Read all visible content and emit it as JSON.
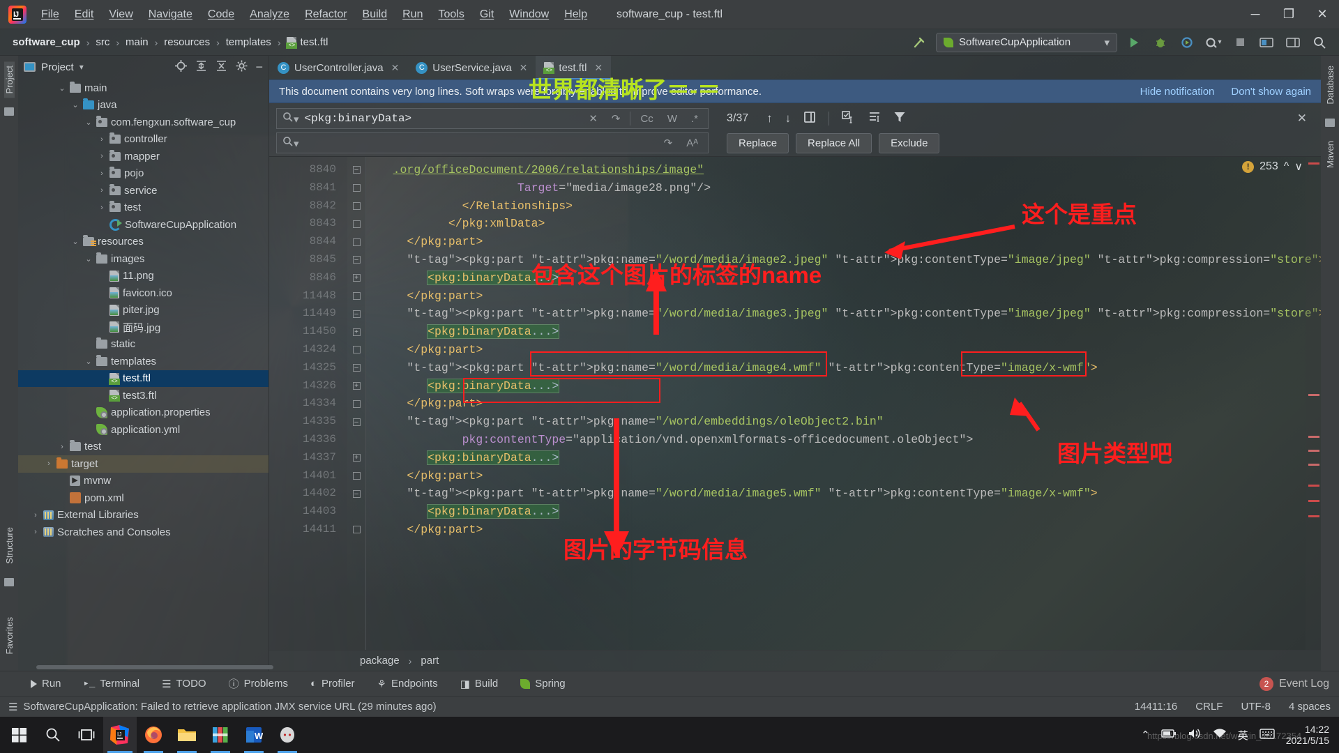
{
  "titlebar": {
    "menu": [
      "File",
      "Edit",
      "View",
      "Navigate",
      "Code",
      "Analyze",
      "Refactor",
      "Build",
      "Run",
      "Tools",
      "Git",
      "Window",
      "Help"
    ],
    "window_title": "software_cup - test.ftl",
    "minimize": "─",
    "maximize": "❐",
    "close": "✕"
  },
  "navbar": {
    "crumbs": [
      "software_cup",
      "src",
      "main",
      "resources",
      "templates",
      "test.ftl"
    ],
    "run_config": "SoftwareCupApplication",
    "hammer_icon": "build-hammer-icon",
    "search_icon": "search-icon"
  },
  "left_strip": {
    "project_label": "Project",
    "structure_label": "Structure",
    "favorites_label": "Favorites"
  },
  "right_strip": {
    "database_label": "Database",
    "maven_label": "Maven"
  },
  "project": {
    "title": "Project",
    "tree": [
      {
        "label": "main",
        "depth": 2,
        "arrow": "⌄",
        "icon": "folder",
        "selected": false
      },
      {
        "label": "java",
        "depth": 3,
        "arrow": "⌄",
        "icon": "folder-blue",
        "selected": false
      },
      {
        "label": "com.fengxun.software_cup",
        "depth": 4,
        "arrow": "⌄",
        "icon": "package",
        "selected": false
      },
      {
        "label": "controller",
        "depth": 5,
        "arrow": "›",
        "icon": "package",
        "selected": false
      },
      {
        "label": "mapper",
        "depth": 5,
        "arrow": "›",
        "icon": "package",
        "selected": false
      },
      {
        "label": "pojo",
        "depth": 5,
        "arrow": "›",
        "icon": "package",
        "selected": false
      },
      {
        "label": "service",
        "depth": 5,
        "arrow": "›",
        "icon": "package",
        "selected": false
      },
      {
        "label": "test",
        "depth": 5,
        "arrow": "›",
        "icon": "package",
        "selected": false
      },
      {
        "label": "SoftwareCupApplication",
        "depth": 5,
        "arrow": "",
        "icon": "spring-boot",
        "selected": false
      },
      {
        "label": "resources",
        "depth": 3,
        "arrow": "⌄",
        "icon": "folder-resources",
        "selected": false
      },
      {
        "label": "images",
        "depth": 4,
        "arrow": "⌄",
        "icon": "folder",
        "selected": false
      },
      {
        "label": "11.png",
        "depth": 5,
        "arrow": "",
        "icon": "image-file",
        "selected": false
      },
      {
        "label": "favicon.ico",
        "depth": 5,
        "arrow": "",
        "icon": "image-file",
        "selected": false
      },
      {
        "label": "piter.jpg",
        "depth": 5,
        "arrow": "",
        "icon": "image-file",
        "selected": false
      },
      {
        "label": "面码.jpg",
        "depth": 5,
        "arrow": "",
        "icon": "image-file",
        "selected": false
      },
      {
        "label": "static",
        "depth": 4,
        "arrow": "",
        "icon": "folder",
        "selected": false
      },
      {
        "label": "templates",
        "depth": 4,
        "arrow": "⌄",
        "icon": "folder",
        "selected": false
      },
      {
        "label": "test.ftl",
        "depth": 5,
        "arrow": "",
        "icon": "ftl-file",
        "selected": true
      },
      {
        "label": "test3.ftl",
        "depth": 5,
        "arrow": "",
        "icon": "ftl-file",
        "selected": false
      },
      {
        "label": "application.properties",
        "depth": 4,
        "arrow": "",
        "icon": "spring-file",
        "selected": false
      },
      {
        "label": "application.yml",
        "depth": 4,
        "arrow": "",
        "icon": "spring-file",
        "selected": false
      },
      {
        "label": "test",
        "depth": 2,
        "arrow": "›",
        "icon": "folder",
        "selected": false
      },
      {
        "label": "target",
        "depth": 1,
        "arrow": "›",
        "icon": "folder-orange",
        "selected": false,
        "highlight": true
      },
      {
        "label": "mvnw",
        "depth": 2,
        "arrow": "",
        "icon": "mvnw-file",
        "selected": false
      },
      {
        "label": "pom.xml",
        "depth": 2,
        "arrow": "",
        "icon": "maven-file",
        "selected": false
      },
      {
        "label": "External Libraries",
        "depth": 0,
        "arrow": "›",
        "icon": "library",
        "selected": false
      },
      {
        "label": "Scratches and Consoles",
        "depth": 0,
        "arrow": "›",
        "icon": "scratches",
        "selected": false
      }
    ]
  },
  "editor": {
    "tabs": [
      {
        "label": "UserController.java",
        "icon": "java-class-icon",
        "active": false
      },
      {
        "label": "UserService.java",
        "icon": "java-class-icon",
        "active": false
      },
      {
        "label": "test.ftl",
        "icon": "ftl-file-icon",
        "active": true
      }
    ],
    "notification": {
      "message": "This document contains very long lines. Soft wraps were forcibly enabled to improve editor performance.",
      "hide_label": "Hide notification",
      "dont_show_label": "Don't show again"
    },
    "find": {
      "query": "<pkg:binaryData>",
      "replace_value": "",
      "counter": "3/37",
      "toggle_case": "Cc",
      "toggle_word": "W",
      "toggle_regex": ".*",
      "buttons": [
        "Replace",
        "Replace All",
        "Exclude"
      ],
      "close_icon": "close-icon",
      "prev_icon": "find-previous-icon",
      "next_icon": "find-next-icon",
      "select_all_icon": "select-all-occurrences-icon",
      "filter_icon": "filter-icon"
    },
    "inspection": {
      "count": "253",
      "up_icon": "prev-problem-icon",
      "down_icon": "next-problem-icon"
    },
    "breadcrumb": [
      "package",
      "part"
    ],
    "lines": [
      {
        "num": "8840",
        "fold": "fold-minus",
        "text": ".org/officeDocument/2006/relationships/image\"",
        "indent": 4,
        "kind": "link"
      },
      {
        "num": "8841",
        "fold": "fold-dot",
        "text": "Target=\"media/image28.png\"/>",
        "indent": 22,
        "kind": "attr-str"
      },
      {
        "num": "8842",
        "fold": "fold-dot",
        "text": "</Relationships>",
        "indent": 14,
        "kind": "tag"
      },
      {
        "num": "8843",
        "fold": "fold-dot",
        "text": "</pkg:xmlData>",
        "indent": 12,
        "kind": "tag"
      },
      {
        "num": "8844",
        "fold": "fold-dot",
        "text": "</pkg:part>",
        "indent": 6,
        "kind": "tag"
      },
      {
        "num": "8845",
        "fold": "fold-minus",
        "text": "<pkg:part pkg:name=\"/word/media/image2.jpeg\" pkg:contentType=\"image/jpeg\" pkg:compression=\"store\">",
        "indent": 6,
        "kind": "part"
      },
      {
        "num": "8846",
        "fold": "fold-plus",
        "text": "<pkg:binaryData...>",
        "indent": 9,
        "kind": "binary"
      },
      {
        "num": "11448",
        "fold": "fold-dot",
        "text": "</pkg:part>",
        "indent": 6,
        "kind": "tag"
      },
      {
        "num": "11449",
        "fold": "fold-minus",
        "text": "<pkg:part pkg:name=\"/word/media/image3.jpeg\" pkg:contentType=\"image/jpeg\" pkg:compression=\"store\">",
        "indent": 6,
        "kind": "part"
      },
      {
        "num": "11450",
        "fold": "fold-plus",
        "text": "<pkg:binaryData...>",
        "indent": 9,
        "kind": "binary"
      },
      {
        "num": "14324",
        "fold": "fold-dot",
        "text": "</pkg:part>",
        "indent": 6,
        "kind": "tag"
      },
      {
        "num": "14325",
        "fold": "fold-minus",
        "text": "<pkg:part pkg:name=\"/word/media/image4.wmf\" pkg:contentType=\"image/x-wmf\">",
        "indent": 6,
        "kind": "part"
      },
      {
        "num": "14326",
        "fold": "fold-plus",
        "text": "<pkg:binaryData...>",
        "indent": 9,
        "kind": "binary"
      },
      {
        "num": "14334",
        "fold": "fold-dot",
        "text": "</pkg:part>",
        "indent": 6,
        "kind": "tag"
      },
      {
        "num": "14335",
        "fold": "fold-minus",
        "text": "<pkg:part pkg:name=\"/word/embeddings/oleObject2.bin\"",
        "indent": 6,
        "kind": "part"
      },
      {
        "num": "14336",
        "fold": "",
        "text": "pkg:contentType=\"application/vnd.openxmlformats-officedocument.oleObject\">",
        "indent": 14,
        "kind": "attr-str"
      },
      {
        "num": "14337",
        "fold": "fold-plus",
        "text": "<pkg:binaryData...>",
        "indent": 9,
        "kind": "binary"
      },
      {
        "num": "14401",
        "fold": "fold-dot",
        "text": "</pkg:part>",
        "indent": 6,
        "kind": "tag"
      },
      {
        "num": "14402",
        "fold": "fold-minus",
        "text": "<pkg:part pkg:name=\"/word/media/image5.wmf\" pkg:contentType=\"image/x-wmf\">",
        "indent": 6,
        "kind": "part"
      },
      {
        "num": "14403",
        "fold": "",
        "text": "<pkg:binaryData...>",
        "indent": 9,
        "kind": "binary"
      },
      {
        "num": "14411",
        "fold": "fold-dot",
        "text": "</pkg:part>",
        "indent": 6,
        "kind": "tag"
      }
    ]
  },
  "annotations": [
    {
      "id": "anno-world-clear",
      "text": "世界都清晰了＝-＝",
      "color": "#b8e41f"
    },
    {
      "id": "anno-key-point",
      "text": "这个是重点",
      "color": "#ff1e1e"
    },
    {
      "id": "anno-tag-name",
      "text": "包含这个图片的标签的name",
      "color": "#ff1e1e"
    },
    {
      "id": "anno-image-type",
      "text": "图片类型吧",
      "color": "#ff1e1e"
    },
    {
      "id": "anno-byte-info",
      "text": "图片的字节码信息",
      "color": "#ff1e1e"
    }
  ],
  "bottom_tools": [
    {
      "label": "Run",
      "icon": "run-icon"
    },
    {
      "label": "Terminal",
      "icon": "terminal-icon"
    },
    {
      "label": "TODO",
      "icon": "todo-icon"
    },
    {
      "label": "Problems",
      "icon": "problems-icon"
    },
    {
      "label": "Profiler",
      "icon": "profiler-icon"
    },
    {
      "label": "Endpoints",
      "icon": "endpoints-icon"
    },
    {
      "label": "Build",
      "icon": "build-icon"
    },
    {
      "label": "Spring",
      "icon": "spring-icon"
    }
  ],
  "event_log": {
    "label": "Event Log",
    "count": "2"
  },
  "statusbar": {
    "message": "SoftwareCupApplication: Failed to retrieve application JMX service URL (29 minutes ago)",
    "caret": "14411:16",
    "line_sep": "CRLF",
    "encoding": "UTF-8",
    "indent": "4 spaces"
  },
  "taskbar": {
    "items": [
      {
        "name": "start-button",
        "icon": "windows-logo"
      },
      {
        "name": "search-taskbar",
        "icon": "search-icon"
      },
      {
        "name": "task-view",
        "icon": "task-view-icon"
      },
      {
        "name": "intellij-idea",
        "icon": "intellij-icon",
        "active": true
      },
      {
        "name": "firefox",
        "icon": "firefox-icon",
        "running": true
      },
      {
        "name": "file-explorer",
        "icon": "explorer-icon",
        "running": true
      },
      {
        "name": "winrar",
        "icon": "winrar-icon",
        "running": true
      },
      {
        "name": "word",
        "icon": "word-icon",
        "running": true
      },
      {
        "name": "other-app",
        "icon": "avatar-icon",
        "running": true
      }
    ],
    "tray": {
      "chevron": "⌃",
      "ime": "英",
      "time": "14:22",
      "date": "2021/5/15"
    },
    "watermark": "https://blog.csdn.net/weixin_46172354"
  }
}
